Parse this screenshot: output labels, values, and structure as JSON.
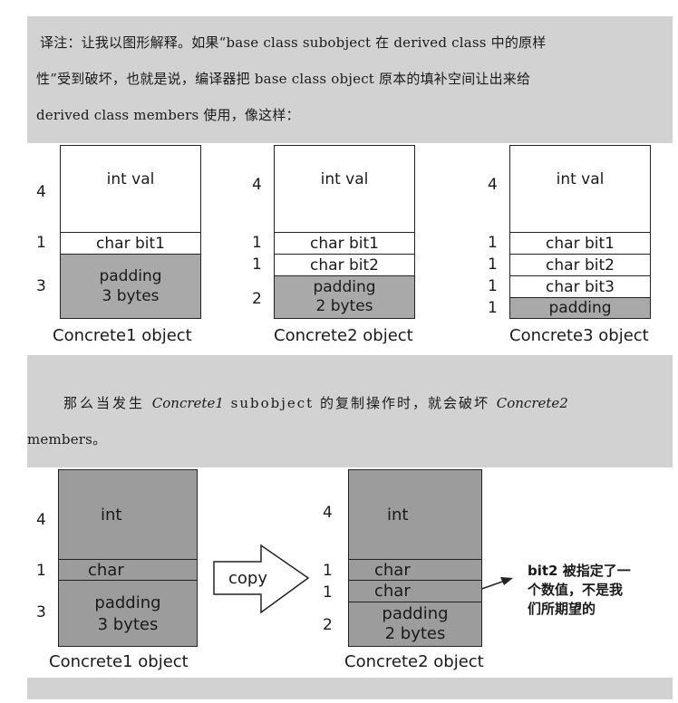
{
  "note": {
    "line1": "译注：让我以图形解释。如果“base class subobject 在 derived class 中的原样",
    "line2": "性”受到破坏，也就是说，编译器把 base class object 原本的填补空间让出来给",
    "line3": "derived class members 使用，像这样："
  },
  "diagram1": {
    "c1": {
      "caption": "Concrete1 object",
      "nums": [
        "4",
        "1",
        "3"
      ],
      "val": "int val",
      "bit1": "char bit1",
      "padding_l1": "padding",
      "padding_l2": "3 bytes"
    },
    "c2": {
      "caption": "Concrete2 object",
      "nums": [
        "4",
        "1",
        "1",
        "2"
      ],
      "val": "int val",
      "bit1": "char bit1",
      "bit2": "char bit2",
      "padding_l1": "padding",
      "padding_l2": "2 bytes"
    },
    "c3": {
      "caption": "Concrete3 object",
      "nums": [
        "4",
        "1",
        "1",
        "1",
        "1"
      ],
      "val": "int val",
      "bit1": "char bit1",
      "bit2": "char bit2",
      "bit3": "char bit3",
      "padding": "padding"
    }
  },
  "middle": {
    "line1_a": "那么当发生",
    "line1_b": "Concrete1",
    "line1_c": "subobject 的复制操作时，就会破坏",
    "line1_d": "Concrete2",
    "line2": "members。"
  },
  "diagram2": {
    "left": {
      "caption": "Concrete1 object",
      "nums": [
        "4",
        "1",
        "3"
      ],
      "int": "int",
      "char": "char",
      "padding_l1": "padding",
      "padding_l2": "3 bytes"
    },
    "arrow_label": "copy",
    "right": {
      "caption": "Concrete2 object",
      "nums": [
        "4",
        "1",
        "1",
        "2"
      ],
      "int": "int",
      "char1": "char",
      "char2": "char",
      "padding_l1": "padding",
      "padding_l2": "2 bytes"
    },
    "annotation": {
      "l1": "bit2 被指定了一",
      "l2": "个数值，不是我",
      "l3": "们所期望的"
    }
  }
}
